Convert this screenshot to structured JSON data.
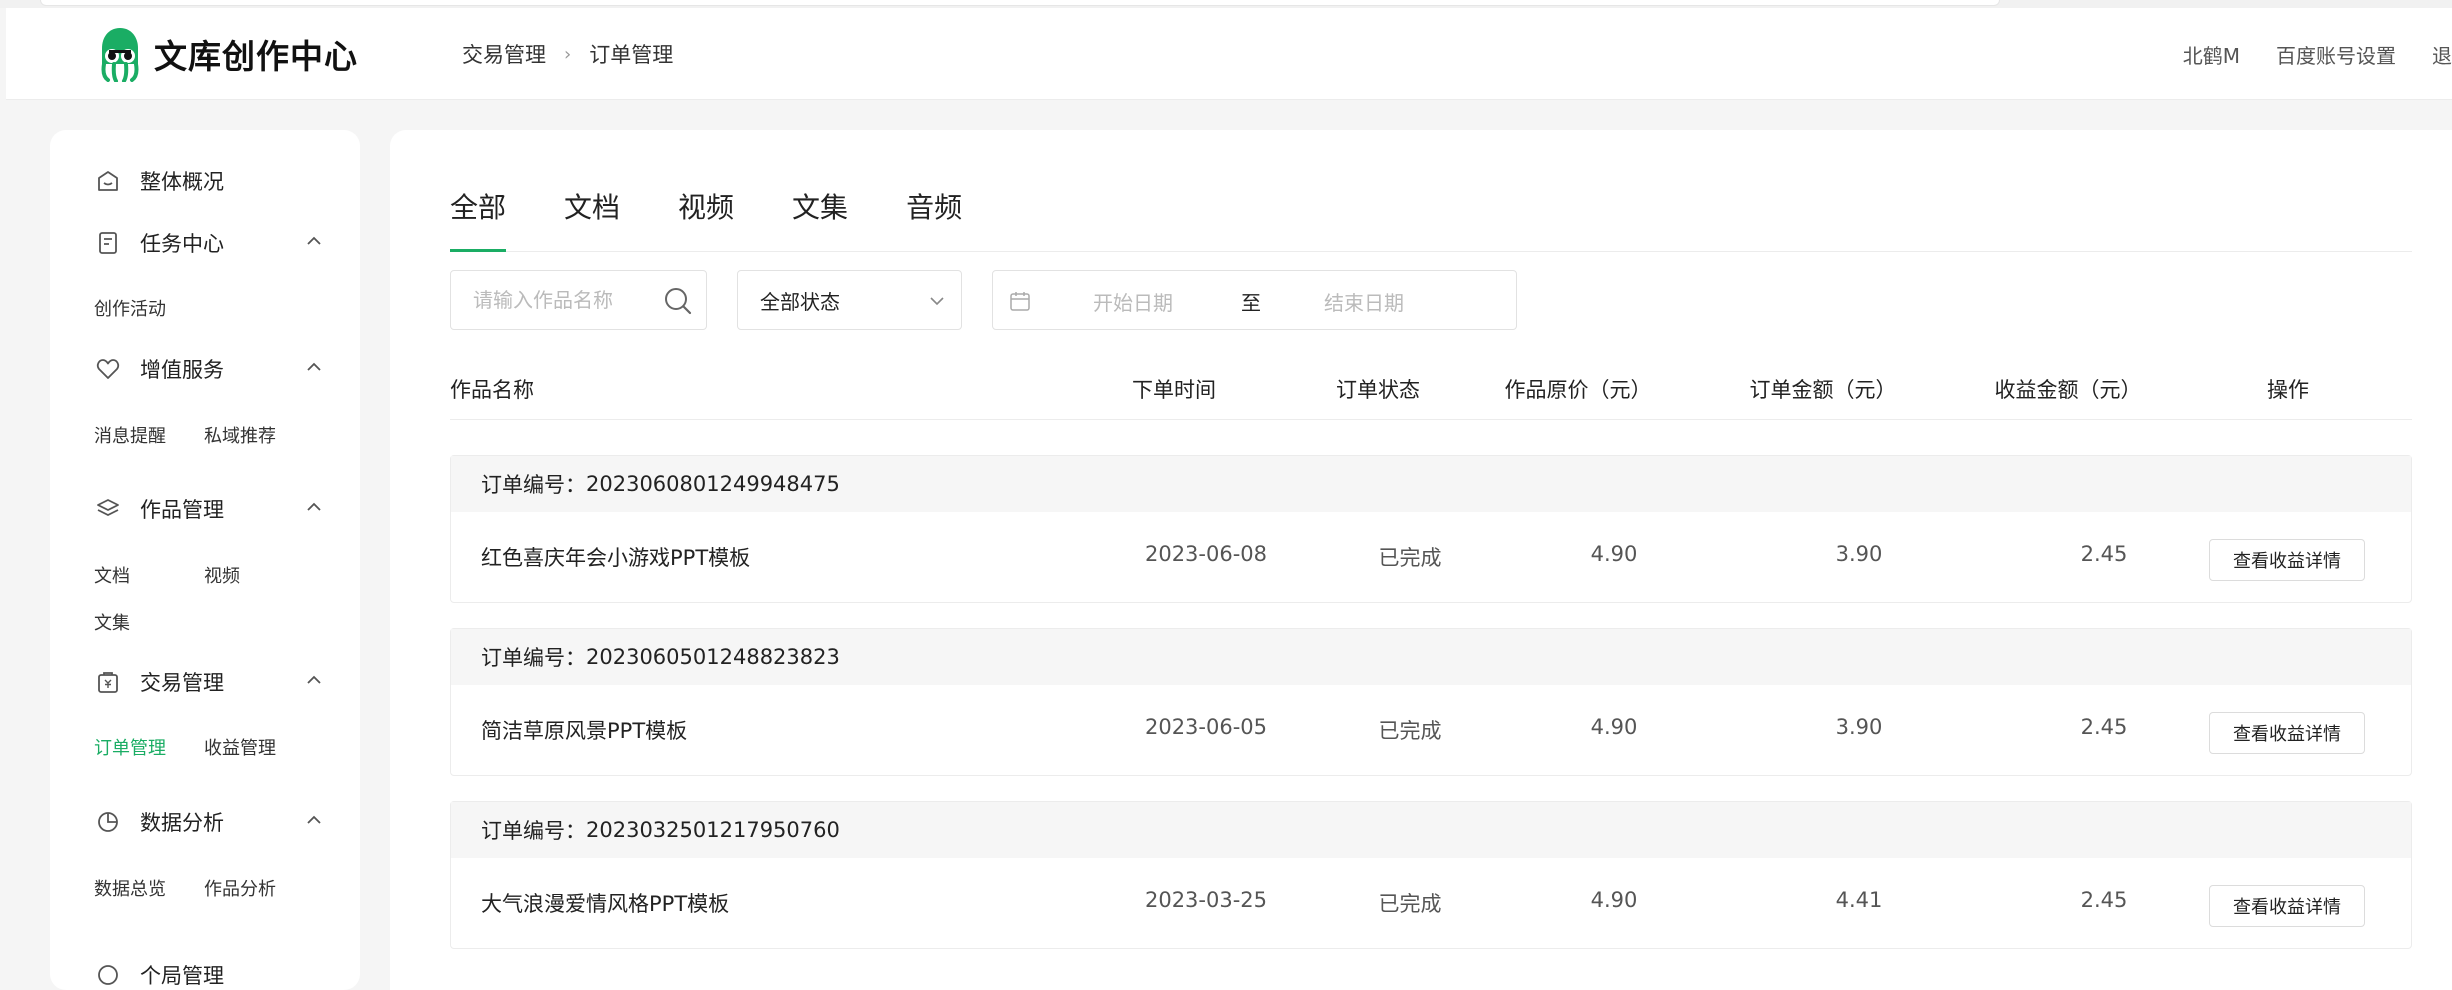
{
  "app": {
    "logo_text": "文库创作中心"
  },
  "breadcrumb": [
    "交易管理",
    "订单管理"
  ],
  "header_right": {
    "username": "北鹤M",
    "account_settings": "百度账号设置",
    "exit": "退"
  },
  "sidebar": {
    "groups": [
      {
        "label": "整体概况",
        "icon": "home-icon",
        "items": []
      },
      {
        "label": "任务中心",
        "icon": "task-icon",
        "items": [
          "创作活动"
        ]
      },
      {
        "label": "增值服务",
        "icon": "heart-icon",
        "items": [
          "消息提醒",
          "私域推荐"
        ]
      },
      {
        "label": "作品管理",
        "icon": "layers-icon",
        "items": [
          "文档",
          "视频",
          "文集"
        ]
      },
      {
        "label": "交易管理",
        "icon": "bag-icon",
        "items": [
          "订单管理",
          "收益管理"
        ],
        "active_item": "订单管理"
      },
      {
        "label": "数据分析",
        "icon": "pie-chart-icon",
        "items": [
          "数据总览",
          "作品分析"
        ]
      },
      {
        "label": "个局管理",
        "icon": "settings-icon",
        "items": []
      }
    ]
  },
  "tabs": [
    {
      "label": "全部",
      "active": true
    },
    {
      "label": "文档",
      "active": false
    },
    {
      "label": "视频",
      "active": false
    },
    {
      "label": "文集",
      "active": false
    },
    {
      "label": "音频",
      "active": false
    }
  ],
  "filters": {
    "search_placeholder": "请输入作品名称",
    "status_value": "全部状态",
    "start_placeholder": "开始日期",
    "to_label": "至",
    "end_placeholder": "结束日期"
  },
  "table": {
    "columns": [
      "作品名称",
      "下单时间",
      "订单状态",
      "作品原价（元）",
      "订单金额（元）",
      "收益金额（元）",
      "操作"
    ],
    "order_prefix": "订单编号：",
    "rows": [
      {
        "order_no": "2023060801249948475",
        "name": "红色喜庆年会小游戏PPT模板",
        "date": "2023-06-08",
        "status": "已完成",
        "original_price": "4.90",
        "order_amount": "3.90",
        "income": "2.45",
        "action": "查看收益详情"
      },
      {
        "order_no": "2023060501248823823",
        "name": "简洁草原风景PPT模板",
        "date": "2023-06-05",
        "status": "已完成",
        "original_price": "4.90",
        "order_amount": "3.90",
        "income": "2.45",
        "action": "查看收益详情"
      },
      {
        "order_no": "2023032501217950760",
        "name": "大气浪漫爱情风格PPT模板",
        "date": "2023-03-25",
        "status": "已完成",
        "original_price": "4.90",
        "order_amount": "4.41",
        "income": "2.45",
        "action": "查看收益详情"
      }
    ]
  },
  "colors": {
    "accent": "#1aad64"
  }
}
